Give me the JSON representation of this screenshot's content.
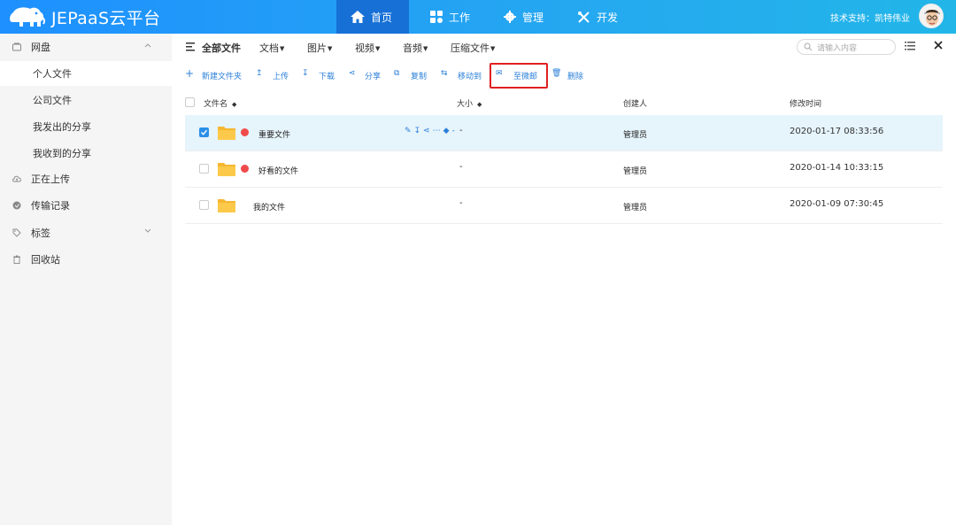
{
  "app": {
    "title": "JEPaaS云平台",
    "support_text": "技术支持：凯特伟业"
  },
  "nav": {
    "items": [
      {
        "label": "首页",
        "icon": "home-icon",
        "active": true
      },
      {
        "label": "工作",
        "icon": "grid-icon",
        "active": false
      },
      {
        "label": "管理",
        "icon": "gear-icon",
        "active": false
      },
      {
        "label": "开发",
        "icon": "tools-icon",
        "active": false
      }
    ]
  },
  "sidebar": {
    "items": [
      {
        "label": "网盘",
        "icon": "disk-icon",
        "expandable": true
      },
      {
        "label": "个人文件",
        "sub": true,
        "selected": true
      },
      {
        "label": "公司文件",
        "sub": true
      },
      {
        "label": "我发出的分享",
        "sub": true
      },
      {
        "label": "我收到的分享",
        "sub": true
      },
      {
        "label": "正在上传",
        "icon": "cloud-upload-icon"
      },
      {
        "label": "传输记录",
        "icon": "transfer-icon"
      },
      {
        "label": "标签",
        "icon": "tag-icon",
        "expandable": true
      },
      {
        "label": "回收站",
        "icon": "trash-icon"
      }
    ]
  },
  "toolbar": {
    "all_files": "全部文件",
    "categories": [
      "文档",
      "图片",
      "视频",
      "音频",
      "压缩文件"
    ],
    "search_placeholder": "请输入内容"
  },
  "actions": [
    {
      "label": "新建文件夹",
      "icon": "plus-icon"
    },
    {
      "label": "上传",
      "icon": "upload-icon"
    },
    {
      "label": "下载",
      "icon": "download-icon"
    },
    {
      "label": "分享",
      "icon": "share-icon"
    },
    {
      "label": "复制",
      "icon": "copy-icon"
    },
    {
      "label": "移动到",
      "icon": "move-icon"
    },
    {
      "label": "至微邮",
      "icon": "mail-icon"
    },
    {
      "label": "删除",
      "icon": "trash-icon"
    }
  ],
  "table": {
    "headers": {
      "name": "文件名",
      "size": "大小",
      "creator": "创建人",
      "mtime": "修改时间"
    },
    "rows": [
      {
        "name": "重要文件",
        "size": "-",
        "creator": "管理员",
        "mtime": "2020-01-17 08:33:56",
        "tagged": true,
        "checked": true,
        "row_tools_suffix": "-"
      },
      {
        "name": "好看的文件",
        "size": "-",
        "creator": "管理员",
        "mtime": "2020-01-14 10:33:15",
        "tagged": true,
        "checked": false
      },
      {
        "name": "我的文件",
        "size": "-",
        "creator": "管理员",
        "mtime": "2020-01-09 07:30:45",
        "tagged": false,
        "checked": false
      }
    ]
  },
  "colors": {
    "header_gradient_start": "#1e90ff",
    "header_gradient_end": "#22b6e8",
    "nav_active": "#1670d6",
    "accent": "#2b7fd8",
    "tag_red": "#f04a4a",
    "folder_yellow": "#f7b731",
    "selected_row": "#e6f4fc",
    "highlight_border": "#e02020"
  }
}
